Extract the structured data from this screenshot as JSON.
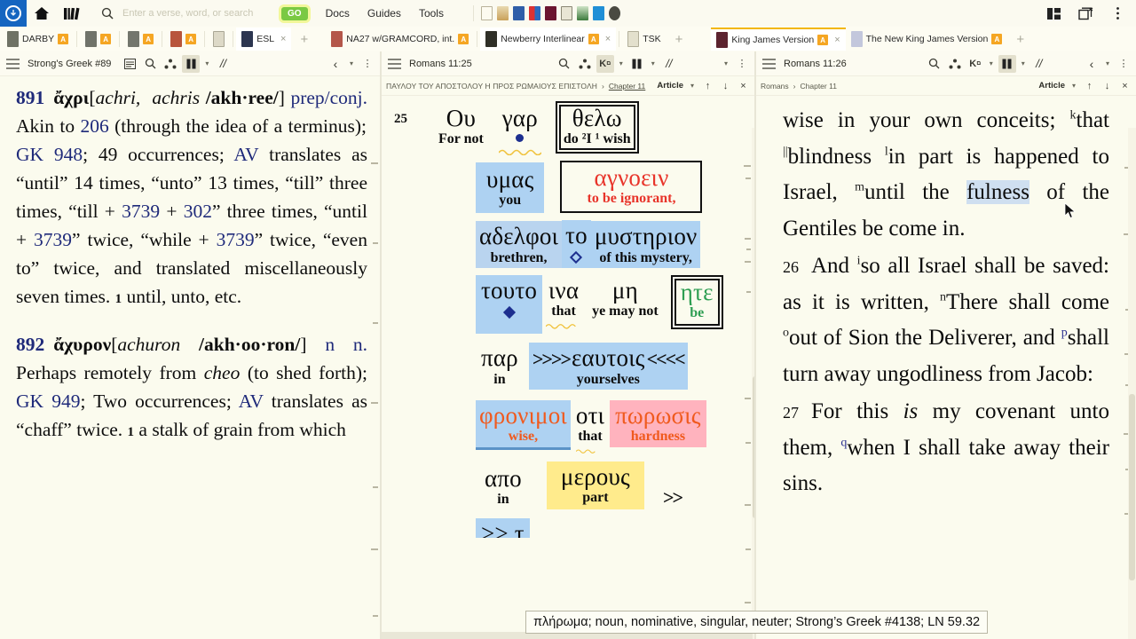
{
  "topbar": {
    "logo_icon": "app-logo-icon",
    "home_icon": "home-icon",
    "library_icon": "library-icon",
    "search_icon": "search-icon",
    "search_placeholder": "Enter a verse, word, or search",
    "search_value": "",
    "go_label": "GO",
    "links": [
      "Docs",
      "Guides",
      "Tools"
    ],
    "right_icons": [
      "panel-layout-icon",
      "new-window-icon",
      "overflow-menu-icon"
    ]
  },
  "tabs": {
    "group_left": [
      {
        "label": "DARBY",
        "badge": "A",
        "color": "#6f7265"
      },
      {
        "label": "",
        "badge": "A",
        "color": "#70736a"
      },
      {
        "label": "",
        "badge": "A",
        "color": "#73766d"
      },
      {
        "label": "",
        "badge": "A",
        "color": "#b8553c"
      },
      {
        "label": "",
        "badge": "",
        "color": "#d7d5c6"
      },
      {
        "label": "ESL",
        "badge": "",
        "color": "#2c3550"
      }
    ],
    "group_mid": [
      {
        "label": "NA27 w/GRAMCORD, int.",
        "badge": "A",
        "color": "#b4574a"
      },
      {
        "label": "Newberry Interlinear",
        "badge": "A",
        "color": "#2f2f28"
      },
      {
        "label": "TSK",
        "badge": "",
        "color": "#dedbc9"
      }
    ],
    "group_right": [
      {
        "label": "King James Version",
        "badge": "A",
        "color": "#5c2330"
      },
      {
        "label": "The New King James Version",
        "badge": "A",
        "color": "#c3c7dc"
      }
    ],
    "add_tab_label": "+",
    "close_label": "×"
  },
  "panes": {
    "left": {
      "header": {
        "menu_icon": "hamburger-icon",
        "title": "Strong's Greek #89",
        "icons": [
          "notes-icon",
          "search-icon",
          "graph-icon",
          "parallel-icon"
        ],
        "link_icon": "//",
        "nav_back_icon": "‹",
        "caret_icon": "▾",
        "overflow_icon": "⋮"
      },
      "entries": [
        {
          "number": "891",
          "greek": "ἄχρι",
          "translit": "achri,",
          "translit2": "achris",
          "pron": "/akh·ree/",
          "pos": "prep/conj.",
          "body_1": " Akin to ",
          "akin_ref": "206",
          "body_2": " (through the idea of a terminus); ",
          "gk_label": "GK",
          "gk_num": "948",
          "body_3": "; 49 occurrences; ",
          "av_label": "AV",
          "body_4": " translates as “until” 14 times, “unto” 13 times, “till” three times, “till + ",
          "ref_a": "3739",
          "plus": " + ",
          "ref_b": "302",
          "body_5": "” three times, “until + ",
          "ref_c": "3739",
          "body_6": "” twice, “while + ",
          "ref_d": "3739",
          "body_7": "” twice, “even to” twice, and translated miscellaneously seven times. ",
          "sense_num": "1",
          "sense_text": " until, unto, etc."
        },
        {
          "number": "892",
          "greek": "ἄχυρον",
          "translit": "achuron",
          "pron": "/akh·oo·ron/",
          "pos": "n n.",
          "body_1": " Perhaps remotely from ",
          "from_word": "cheo",
          "body_2": " (to shed forth); ",
          "gk_label": "GK",
          "gk_num": "949",
          "body_3": "; Two occurrences; ",
          "av_label": "AV",
          "body_4": " translates as “chaff” twice. ",
          "sense_num": "1",
          "sense_text": " a stalk of grain from which"
        }
      ]
    },
    "mid": {
      "header": {
        "menu_icon": "hamburger-icon",
        "title": "Romans 11:25",
        "icons": [
          "search-icon",
          "graph-icon",
          "greek-keyboard-icon",
          "parallel-icon"
        ],
        "link_icon": "//",
        "caret_icon": "▾",
        "overflow_icon": "⋮"
      },
      "subheader": {
        "greek_title": "ΠΑΥΛΟΥ ΤΟΥ ΑΠΟΣΤΟΛΟΥ Η ΠΡΟΣ ΡΩΜΑΙΟΥΣ ΕΠΙΣΤΟΛΗ",
        "sep": "›",
        "chapter": "Chapter 11",
        "article_label": "Article",
        "up_icon": "arrow-up-icon",
        "down_icon": "arrow-down-icon",
        "close_icon": "×"
      },
      "verse_number": "25",
      "rows": [
        {
          "cells": [
            {
              "greek": "Ου",
              "english": "For not",
              "style": "plain"
            },
            {
              "greek": "γαρ",
              "english": "",
              "style": "dot"
            },
            {
              "greek": "θελω",
              "english": "do ²I ¹ wish",
              "style": "boxed-double"
            }
          ]
        },
        {
          "cells": [
            {
              "greek": "υμας",
              "english": "you",
              "style": "hl-blue"
            },
            {
              "greek": "αγνοειν",
              "english": "to be ignorant,",
              "style": "boxed-red"
            }
          ]
        },
        {
          "cells": [
            {
              "greek": "αδελφοι",
              "english": "brethren,",
              "style": "hl-blue-soft"
            },
            {
              "greek": "το",
              "english": "",
              "style": "hl-blue-diamond-open"
            },
            {
              "greek": "μυστηριον",
              "english": "of this mystery,",
              "style": "hl-blue"
            }
          ]
        },
        {
          "cells": [
            {
              "greek": "τουτο",
              "english": "",
              "style": "hl-blue-diamond"
            },
            {
              "greek": "ινα",
              "english": "that",
              "style": "plain"
            },
            {
              "greek": "μη",
              "english": "ye may not",
              "style": "plain"
            },
            {
              "greek": "ητε",
              "english": "be",
              "style": "boxed-green"
            }
          ]
        },
        {
          "cells": [
            {
              "greek": "παρ",
              "english": "in",
              "style": "plain"
            },
            {
              "greek": "εαυτοις",
              "english": "yourselves",
              "style": "hl-blue-arrows",
              "pre": ">>>>",
              "post": "<<<<"
            }
          ]
        },
        {
          "cells": [
            {
              "greek": "φρονιμοι",
              "english": "wise,",
              "style": "hl-blue-orange"
            },
            {
              "greek": "οτι",
              "english": "that",
              "style": "plain"
            },
            {
              "greek": "πωρωσις",
              "english": "hardness",
              "style": "hl-pink-orange"
            }
          ]
        },
        {
          "cells": [
            {
              "greek": "απο",
              "english": "in",
              "style": "plain"
            },
            {
              "greek": "μερους",
              "english": "part",
              "style": "hl-yellow"
            },
            {
              "greek": ">>",
              "english": "",
              "style": "arrows-only"
            }
          ]
        }
      ]
    },
    "right": {
      "header": {
        "menu_icon": "hamburger-icon",
        "title": "Romans 11:26",
        "icons": [
          "search-icon",
          "graph-icon",
          "greek-keyboard-icon",
          "parallel-icon"
        ],
        "link_icon": "//",
        "nav_back_icon": "‹",
        "caret_icon": "▾",
        "overflow_icon": "⋮"
      },
      "subheader": {
        "book": "Romans",
        "sep": "›",
        "chapter": "Chapter 11",
        "article_label": "Article",
        "up_icon": "arrow-up-icon",
        "down_icon": "arrow-down-icon",
        "close_icon": "×"
      },
      "verses": [
        {
          "number": "",
          "parts": [
            {
              "t": "wise in your own conceits; ",
              "k": "plain"
            },
            {
              "t": "k",
              "k": "sup"
            },
            {
              "t": "that ",
              "k": "plain"
            },
            {
              "t": "||",
              "k": "sup"
            },
            {
              "t": "blindness ",
              "k": "plain"
            },
            {
              "t": "l",
              "k": "sup"
            },
            {
              "t": "in part is happened to Israel, ",
              "k": "plain"
            },
            {
              "t": "m",
              "k": "sup"
            },
            {
              "t": "until the ",
              "k": "plain"
            },
            {
              "t": "fulness",
              "k": "sel"
            },
            {
              "t": " of the Gentiles be come in.",
              "k": "plain"
            }
          ]
        },
        {
          "number": "26",
          "parts": [
            {
              "t": "And ",
              "k": "plain"
            },
            {
              "t": "i",
              "k": "sup"
            },
            {
              "t": "so all Israel shall be saved: as it is written, ",
              "k": "plain"
            },
            {
              "t": "n",
              "k": "sup"
            },
            {
              "t": "There shall come ",
              "k": "plain"
            },
            {
              "t": "o",
              "k": "sup"
            },
            {
              "t": "out of Sion the Deliverer, and ",
              "k": "plain"
            },
            {
              "t": "p",
              "k": "sup"
            },
            {
              "t": "shall turn away ungodliness from Jacob:",
              "k": "plain"
            }
          ]
        },
        {
          "number": "27",
          "parts": [
            {
              "t": "For this ",
              "k": "plain"
            },
            {
              "t": "is",
              "k": "ital"
            },
            {
              "t": " my covenant unto them, ",
              "k": "plain"
            },
            {
              "t": "q",
              "k": "sup"
            },
            {
              "t": "when I shall take away their sins.",
              "k": "plain"
            }
          ]
        }
      ]
    }
  },
  "tooltip": {
    "text": "πλήρωμα; noun, nominative, singular, neuter; Strong’s Greek #4138; LN 59.32"
  },
  "colors": {
    "accent_blue": "#1565c0",
    "go_green": "#7ac943",
    "badge_orange": "#f5a623",
    "highlight_blue": "#aed2f2",
    "highlight_pink": "#ffb3be",
    "highlight_yellow": "#ffeb8c",
    "red_text": "#e8342a",
    "green_text": "#2e9e52",
    "orange_text": "#f05a1e",
    "page_bg": "#fbfbee",
    "strongs_blue": "#1f2a7a"
  }
}
